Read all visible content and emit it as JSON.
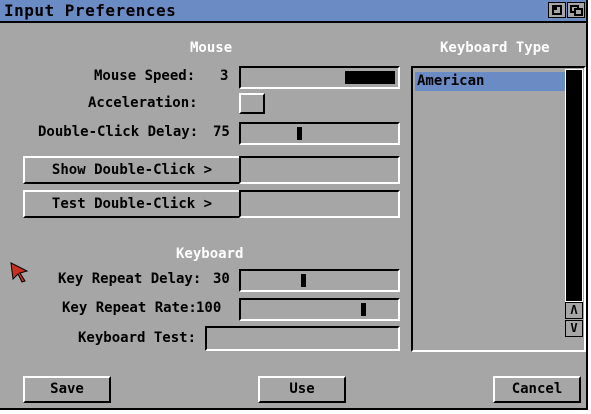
{
  "window": {
    "title": "Input Preferences",
    "depth_gadget_icons": [
      "zoom-icon",
      "depth-icon"
    ]
  },
  "mouse": {
    "header": "Mouse",
    "speed_label": "Mouse Speed:",
    "speed_value": "3",
    "acceleration_label": "Acceleration:",
    "acceleration_checked": false,
    "double_click_label": "Double-Click Delay:",
    "double_click_value": "75",
    "show_double_click_label": "Show Double-Click  >",
    "test_double_click_label": "Test Double-Click  >"
  },
  "keyboard": {
    "header": "Keyboard",
    "repeat_delay_label": "Key Repeat Delay:",
    "repeat_delay_value": "30",
    "repeat_rate_label": "Key Repeat Rate:",
    "repeat_rate_value": "100",
    "test_label": "Keyboard Test:",
    "test_value": ""
  },
  "keyboard_type": {
    "header": "Keyboard Type",
    "items": [
      "American"
    ],
    "selected": "American"
  },
  "buttons": {
    "save": "Save",
    "use": "Use",
    "cancel": "Cancel"
  },
  "colors": {
    "background": "#a6a6a6",
    "accent": "#6b8bc4",
    "header_text": "#ffffff"
  },
  "icons": {
    "scroll_up": "up-arrow-icon",
    "scroll_down": "down-arrow-icon",
    "pointer": "mouse-pointer-icon"
  }
}
